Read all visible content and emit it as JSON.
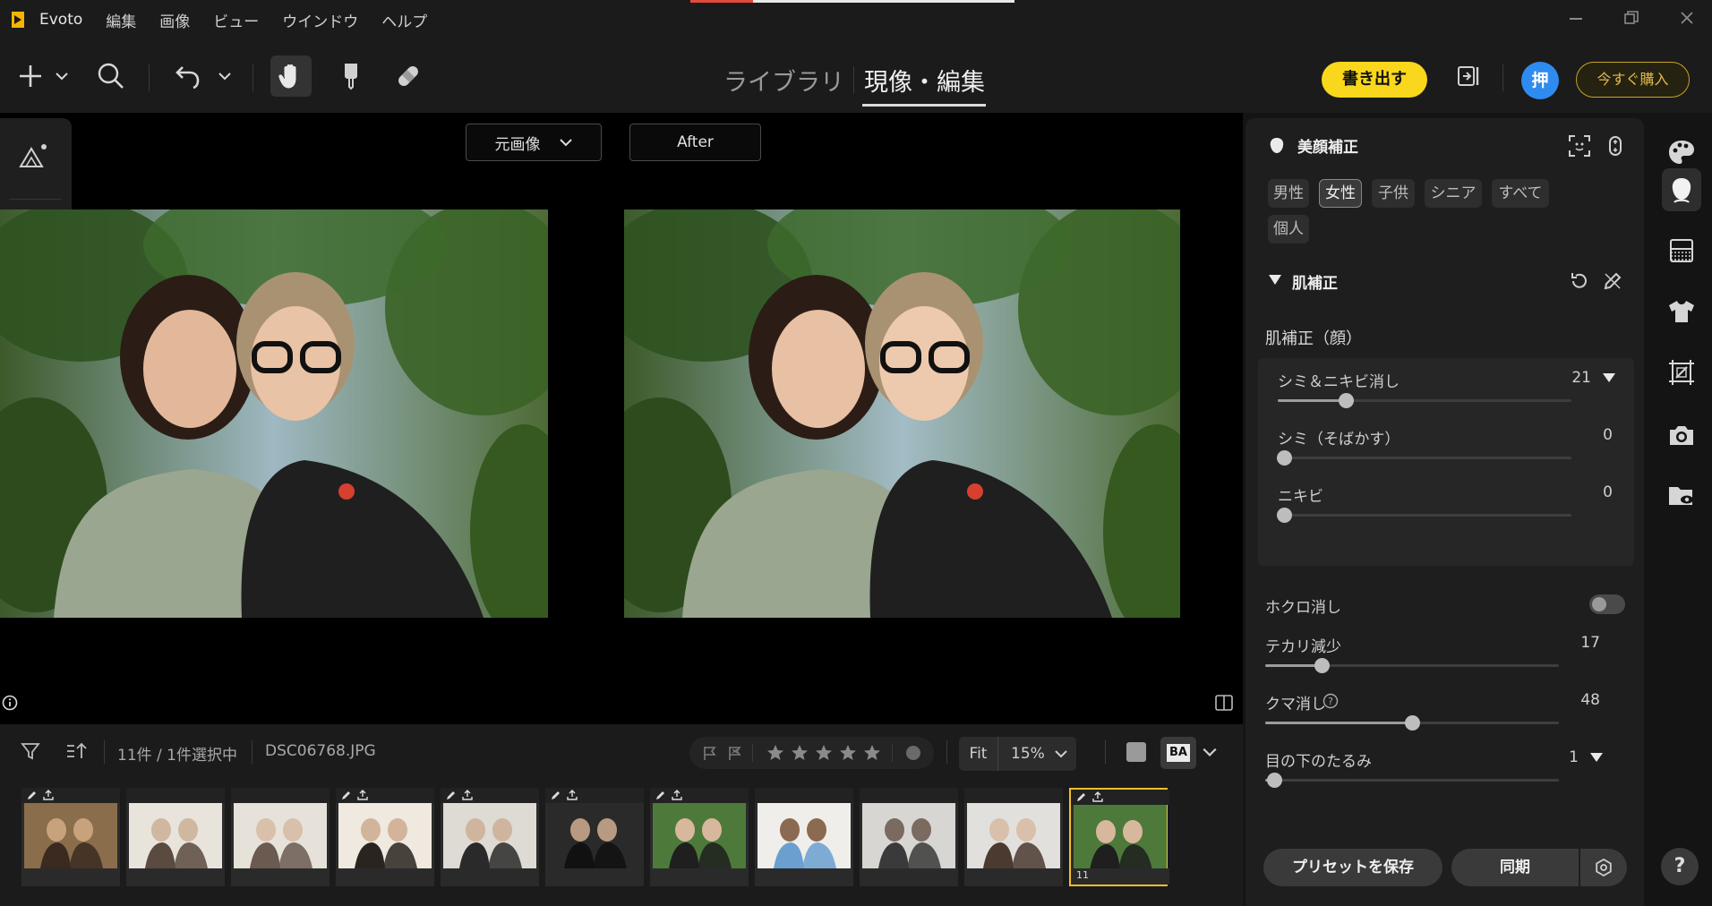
{
  "app": {
    "name": "Evoto",
    "menu": [
      "編集",
      "画像",
      "ビュー",
      "ウインドウ",
      "ヘルプ"
    ]
  },
  "toolbar": {
    "tabs": [
      {
        "label": "ライブラリ",
        "active": false
      },
      {
        "label": "現像・編集",
        "active": true
      }
    ],
    "export_label": "書き出す",
    "avatar_label": "押",
    "buy_label": "今すぐ購入"
  },
  "canvas": {
    "before_select": "元画像",
    "after_label": "After"
  },
  "filmstrip": {
    "count_text": "11件 / 1件選択中",
    "filename": "DSC06768.JPG",
    "fit_label": "Fit",
    "zoom_value": "15%",
    "ba_label": "BA",
    "selected_index_label": "11",
    "thumb_count": 11
  },
  "panel": {
    "title": "美顔補正",
    "chips": [
      {
        "label": "男性",
        "active": false
      },
      {
        "label": "女性",
        "active": true
      },
      {
        "label": "子供",
        "active": false
      },
      {
        "label": "シニア",
        "active": false
      },
      {
        "label": "すべて",
        "active": false
      },
      {
        "label": "個人",
        "active": false
      }
    ],
    "section_title": "肌補正",
    "subsection_title": "肌補正（顔）",
    "sliders_card": [
      {
        "label": "シミ＆ニキビ消し",
        "value": "21",
        "fraction": 0.21,
        "has_dropdown": true
      },
      {
        "label": "シミ（そばかす）",
        "value": "0",
        "fraction": 0.0,
        "has_dropdown": false
      },
      {
        "label": "ニキビ",
        "value": "0",
        "fraction": 0.0,
        "has_dropdown": false
      }
    ],
    "mole_label": "ホクロ消し",
    "mole_enabled": false,
    "sliders_free": [
      {
        "label": "テカリ減少",
        "value": "17",
        "fraction": 0.17,
        "has_dropdown": false,
        "has_info": false
      },
      {
        "label": "クマ消し",
        "value": "48",
        "fraction": 0.48,
        "has_dropdown": false,
        "has_info": true
      },
      {
        "label": "目の下のたるみ",
        "value": "1",
        "fraction": 0.01,
        "has_dropdown": true,
        "has_info": false
      }
    ],
    "save_preset_label": "プリセットを保存",
    "sync_label": "同期"
  },
  "help_label": "?",
  "colors": {
    "accent_yellow": "#f9d71c",
    "avatar_blue": "#2e8cf0",
    "buy_gold": "#e0b94a",
    "progress_red": "#e24a3b",
    "selected_border": "#f2c02a"
  }
}
